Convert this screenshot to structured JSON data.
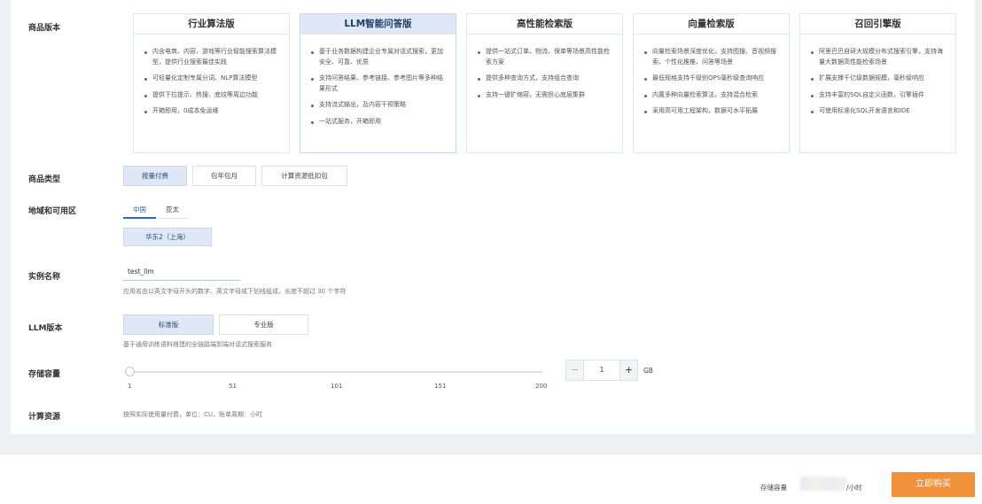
{
  "labels": {
    "edition": "商品版本",
    "type": "商品类型",
    "region": "地域和可用区",
    "instance_name": "实例名称",
    "llm_version": "LLM版本",
    "storage": "存储容量",
    "compute": "计算资源"
  },
  "editions": [
    {
      "title": "行业算法版",
      "features": [
        "内含电商、内容、游戏等行业智能搜索算法模型，提供行业搜索最佳实践",
        "可轻量化定制专属分词、NLP算法模型",
        "提供下拉提示、热搜、底纹等周边功能",
        "开箱即用，0成本免运维"
      ]
    },
    {
      "title": "LLM智能问答版",
      "features": [
        "基于业务数据构建企业专属对话式搜索，更加安全、可靠、优质",
        "支持问答结果、参考链接、参考图片等多种结果形式",
        "支持流式输出，及内容干预策略",
        "一站式服务，开箱即用"
      ]
    },
    {
      "title": "高性能检索版",
      "features": [
        "提供一站式订单、物流、保单等场景高性能检索方案",
        "提供多种查询方式，支持组合查询",
        "支持一键扩缩容，无需担心底层集群"
      ]
    },
    {
      "title": "向量检索版",
      "features": [
        "向量检索场景深度优化，支持图搜、音视频搜索、个性化推推、问答等场景",
        "最低规格支持千级别QPS毫秒级查询响应",
        "内置多种向量检索算法，支持混合检索",
        "采用高可用工程架构，数据可水平拓展"
      ]
    },
    {
      "title": "召回引擎版",
      "features": [
        "阿里巴巴自研大规模分布式搜索引擎，支持海量大数据高性能检索场景",
        "扩展支撑千亿级数据规模，毫秒级响应",
        "支持丰富的SQL自定义函数，引擎插件",
        "可使用标准化SQL开发语言和IDE"
      ]
    }
  ],
  "product_types": [
    "按量付费",
    "包年包月",
    "计算资源抵扣包"
  ],
  "region_tabs": [
    "中国",
    "亚太"
  ],
  "zone": "华东2（上海）",
  "instance": {
    "value": "test_llm",
    "hint": "应用名由以英文字母开头的数字、英文字母或下划线组成，长度不超过 30 个字符"
  },
  "llm_versions": [
    "标准版",
    "专业版"
  ],
  "llm_hint": "基于通用训练语料搭建的全链路端到端对话式搜索服务",
  "storage": {
    "ticks": [
      "1",
      "51",
      "101",
      "151",
      "200"
    ],
    "value": "1",
    "unit": "GB",
    "minus": "−",
    "plus": "+"
  },
  "compute_hint": "按照实际使用量付费，单位：CU，账单周期：小时",
  "footer": {
    "label": "存储容量",
    "price_unit": "/小时",
    "buy": "立即购买"
  },
  "colors": {
    "accent": "#2c67c7",
    "selected_bg": "#dfe8f6",
    "buy": "#f0913a"
  }
}
